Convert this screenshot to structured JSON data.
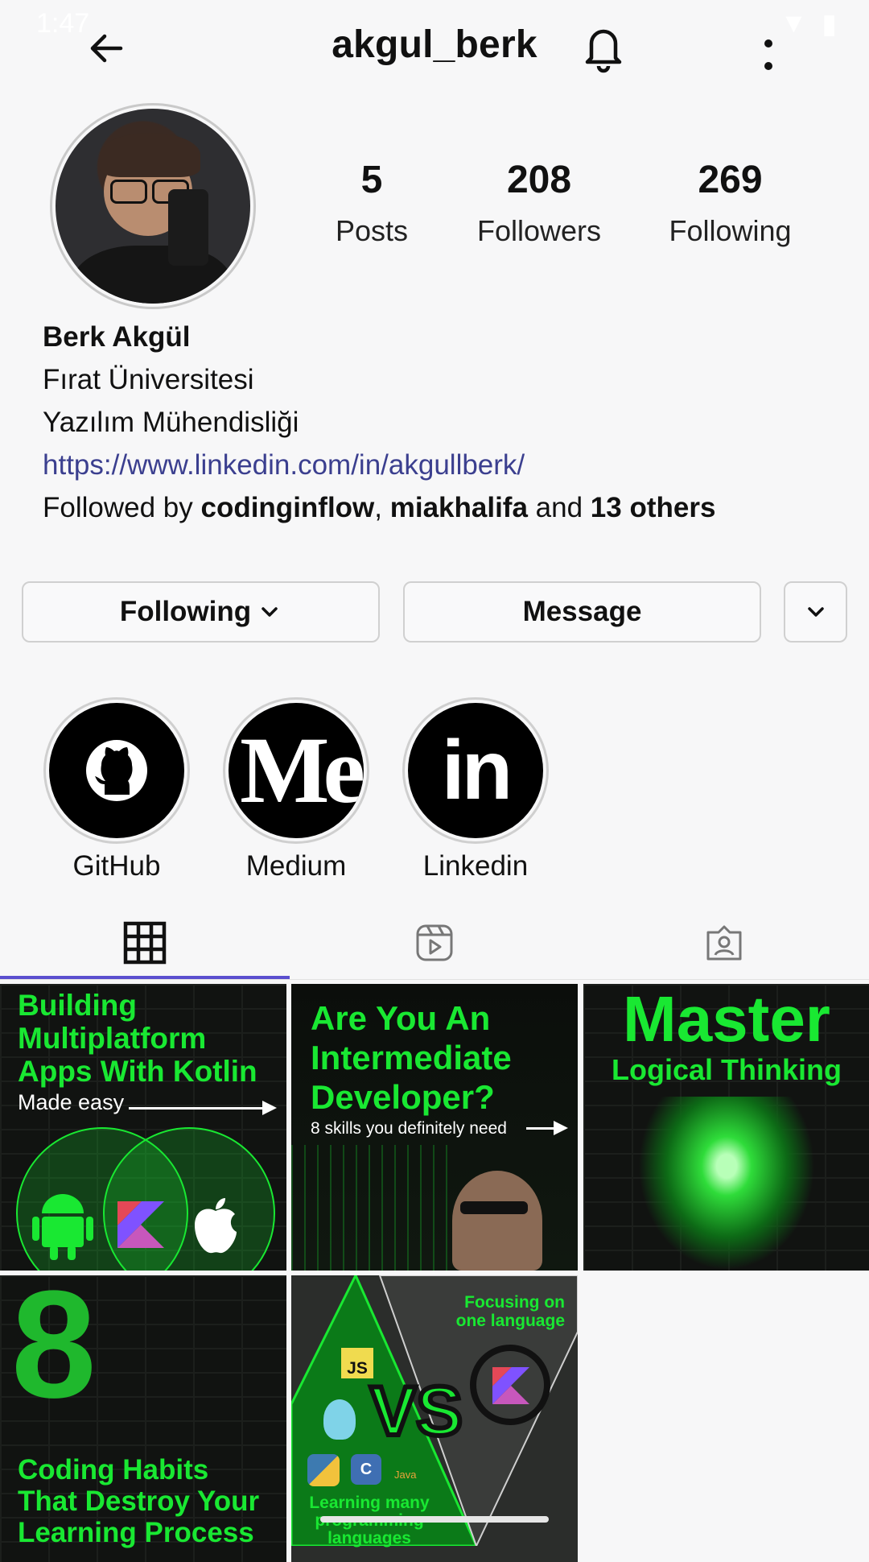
{
  "status": {
    "time": "1:47"
  },
  "header": {
    "title": "akgul_berk"
  },
  "stats": [
    {
      "num": "5",
      "label": "Posts"
    },
    {
      "num": "208",
      "label": "Followers"
    },
    {
      "num": "269",
      "label": "Following"
    }
  ],
  "bio": {
    "name": "Berk Akgül",
    "line1": "Fırat Üniversitesi",
    "line2": "Yazılım Mühendisliği",
    "link": "https://www.linkedin.com/in/akgullberk/",
    "followed_prefix": "Followed by ",
    "followed_user1": "codinginflow",
    "followed_sep": ", ",
    "followed_user2": "miakhalifa",
    "followed_and": " and ",
    "followed_others": "13 others"
  },
  "actions": {
    "following": "Following",
    "message": "Message"
  },
  "highlights": [
    {
      "label": "GitHub",
      "icon": "github-icon"
    },
    {
      "label": "Medium",
      "icon": "medium-icon",
      "mark": "Me"
    },
    {
      "label": "Linkedin",
      "icon": "linkedin-icon",
      "mark": "in"
    }
  ],
  "posts": [
    {
      "l1": "Building",
      "l2": "Multiplatform",
      "l3": "Apps With Kotlin",
      "sub": "Made easy"
    },
    {
      "l1": "Are You An",
      "l2": "Intermediate",
      "l3": "Developer?",
      "sub": "8 skills you definitely need"
    },
    {
      "l1": "Master",
      "l2": "Logical Thinking"
    },
    {
      "big": "8",
      "l1": "Coding Habits",
      "l2": "That Destroy Your",
      "l3": "Learning Process"
    },
    {
      "top1": "Focusing on",
      "top2": "one language",
      "vs": "VS",
      "js": "JS",
      "java": "Java",
      "bottom1": "Learning many",
      "bottom2": "programming",
      "bottom3": "languages"
    }
  ],
  "colors": {
    "accent": "#5b4fcf",
    "neon": "#19e832",
    "link": "#3b3f8f"
  }
}
